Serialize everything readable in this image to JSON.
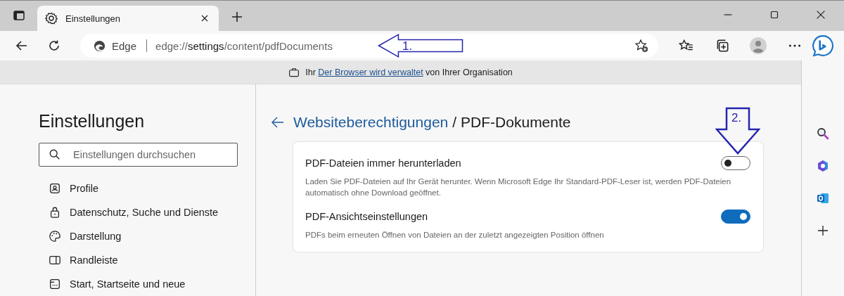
{
  "tab": {
    "title": "Einstellungen",
    "selected": true
  },
  "address_bar": {
    "site_label": "Edge",
    "url": "edge://**settings**/content/pdfDocuments"
  },
  "banner": {
    "prefix": "Ihr",
    "link": "Der Browser wird verwaltet",
    "suffix": "von Ihrer Organisation"
  },
  "sidebar": {
    "title": "Einstellungen",
    "search": {
      "placeholder": "Einstellungen durchsuchen"
    },
    "items": [
      {
        "label": "Profile"
      },
      {
        "label": "Datenschutz, Suche und Dienste"
      },
      {
        "label": "Darstellung"
      },
      {
        "label": "Randleiste"
      },
      {
        "label": "Start, Startseite und neue"
      }
    ]
  },
  "breadcrumb": {
    "parent": "Websiteberechtigungen",
    "separator": "/",
    "current": "PDF-Dokumente"
  },
  "settings": [
    {
      "title": "PDF-Dateien immer herunterladen",
      "description": "Laden Sie PDF-Dateien auf Ihr Gerät herunter. Wenn Microsoft Edge Ihr Standard-PDF-Leser ist, werden PDF-Dateien automatisch ohne Download geöffnet.",
      "on": false
    },
    {
      "title": "PDF-Ansichtseinstellungen",
      "description": "PDFs beim erneuten Öffnen von Dateien an der zuletzt angezeigten Position öffnen",
      "on": true
    }
  ],
  "annotations": [
    {
      "label": "1.",
      "kind": "left"
    },
    {
      "label": "2.",
      "kind": "down"
    }
  ]
}
